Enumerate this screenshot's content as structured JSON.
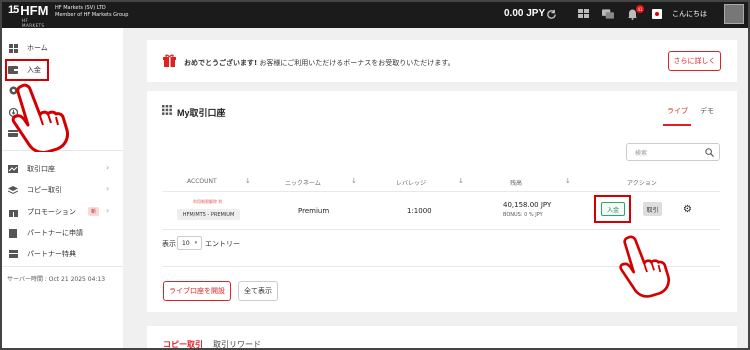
{
  "topbar": {
    "logo_number": "15",
    "logo_text": "HFM",
    "logo_sub": "HF MARKETS",
    "company_line1": "HF Markets (SV) LTD",
    "company_line2": "Member of HF Markets Group",
    "balance": "0.00 JPY",
    "notification_count": "41",
    "greeting": "こんにちは"
  },
  "sidebar": {
    "items": [
      {
        "label": "ホーム",
        "icon": "grid-icon"
      },
      {
        "label": "入金",
        "icon": "wallet-icon"
      },
      {
        "label": "",
        "icon": "coins-icon"
      },
      {
        "label": "",
        "icon": "withdraw-icon"
      },
      {
        "label": "",
        "icon": "card-icon"
      },
      {
        "label": "取引口座",
        "icon": "chart-icon"
      },
      {
        "label": "コピー取引",
        "icon": "layers-icon"
      },
      {
        "label": "プロモーション",
        "icon": "gift-icon",
        "badge": "新"
      },
      {
        "label": "パートナーに申請",
        "icon": "doc-icon"
      },
      {
        "label": "パートナー特典",
        "icon": "table-icon"
      }
    ],
    "server_time": "サーバー時間 : Oct 21 2025 04:13"
  },
  "bonus_banner": {
    "title": "おめでとうございます!",
    "message": "お客様にご利用いただけるボーナスをお受取りいただけます。",
    "button": "さらに詳しく"
  },
  "accounts": {
    "title": "My取引口座",
    "tab_live": "ライブ",
    "tab_demo": "デモ",
    "search_placeholder": "検索",
    "columns": [
      "ACCOUNT",
      "ニックネーム",
      "レバレッジ",
      "残高",
      "アクション"
    ],
    "row": {
      "account_label": "利用制限解除 利",
      "account_type": "HFM/MT5 - PREMIUM",
      "nickname": "Premium",
      "leverage": "1:1000",
      "balance": "40,158.00 JPY",
      "bonus": "BONUS: 0 % JPY",
      "deposit_button": "入金",
      "trade_button": "取引"
    },
    "show_label": "表示",
    "entries_value": "10",
    "entries_label": "エントリー",
    "open_button": "ライブ口座を開設",
    "all_button": "全て表示"
  },
  "copy_tabs": {
    "tab1": "コピー取引",
    "tab2": "取引リワード"
  },
  "colors": {
    "accent": "#d22222",
    "highlight_box": "#d40000",
    "topbar": "#1b1b1b"
  }
}
